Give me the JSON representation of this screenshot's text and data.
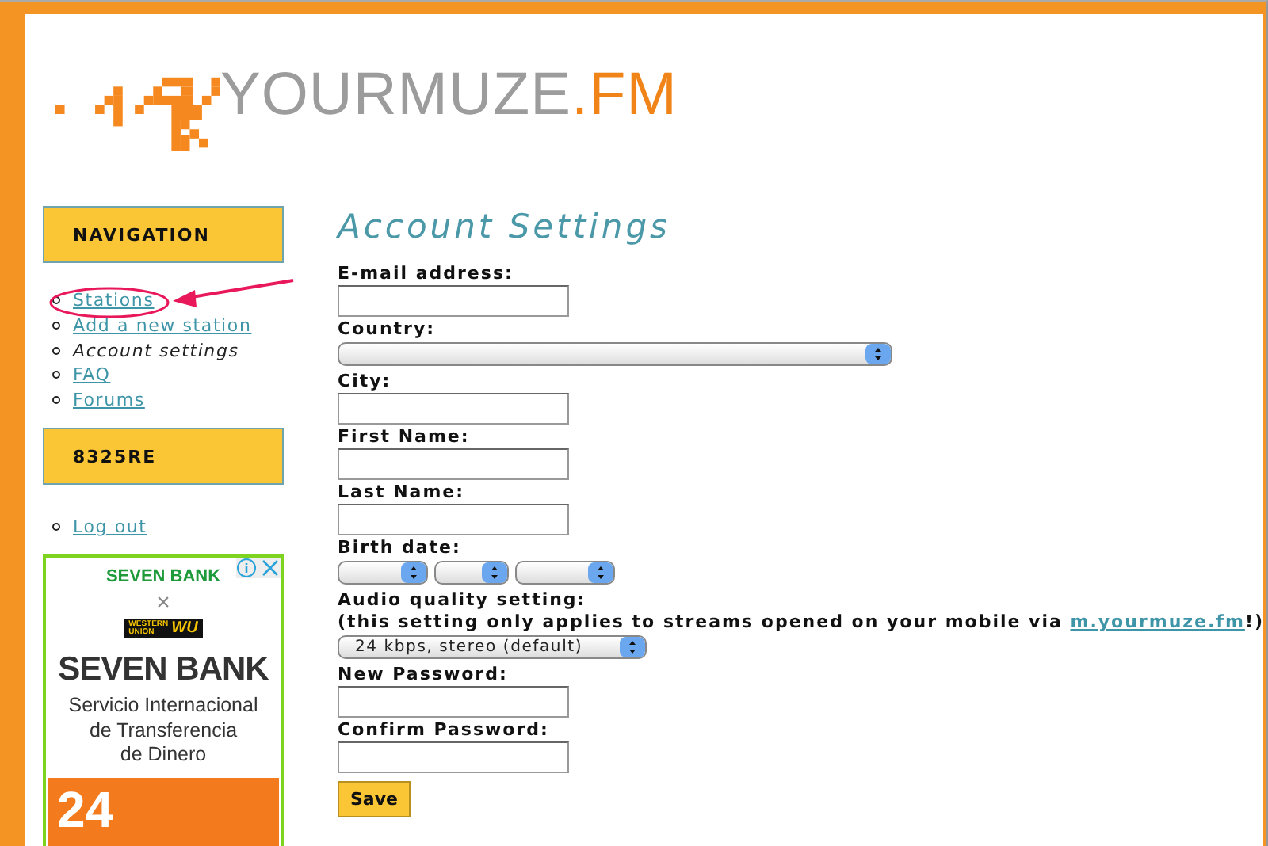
{
  "logo": {
    "name": "YOURMUZE",
    "suffix": ".FM"
  },
  "sidebar": {
    "nav_title": "NAVIGATION",
    "nav_items": [
      {
        "label": "Stations",
        "selected": false,
        "highlighted": true
      },
      {
        "label": "Add a new station",
        "selected": false,
        "highlighted": false
      },
      {
        "label": "Account settings",
        "selected": true,
        "highlighted": false
      },
      {
        "label": "FAQ",
        "selected": false,
        "highlighted": false
      },
      {
        "label": "Forums",
        "selected": false,
        "highlighted": false
      }
    ],
    "user_title": "8325RE",
    "user_items": [
      {
        "label": "Log out"
      }
    ]
  },
  "ad": {
    "brand": "SEVEN BANK",
    "cross": "×",
    "partner_top": "WESTERN",
    "partner_bottom": "UNION",
    "partner_mark": "WU",
    "headline": "SEVEN BANK",
    "lines": [
      "Servicio Internacional",
      "de Transferencia",
      "de Dinero"
    ],
    "banner": "24"
  },
  "page_title": "Account Settings",
  "form": {
    "fields": [
      {
        "kind": "text",
        "label": "E-mail address:"
      },
      {
        "kind": "select",
        "label": "Country:"
      },
      {
        "kind": "text",
        "label": "City:"
      },
      {
        "kind": "text",
        "label": "First Name:"
      },
      {
        "kind": "text",
        "label": "Last Name:"
      },
      {
        "kind": "date",
        "label": "Birth date:"
      },
      {
        "kind": "audio",
        "label": "Audio quality setting:",
        "note_before": "(this setting only applies to streams opened on your mobile via ",
        "note_link": "m.yourmuze.fm",
        "note_after": "!)",
        "value": "24 kbps, stereo (default)"
      },
      {
        "kind": "password",
        "label": "New Password:"
      },
      {
        "kind": "password",
        "label": "Confirm Password:"
      }
    ],
    "save": "Save"
  }
}
